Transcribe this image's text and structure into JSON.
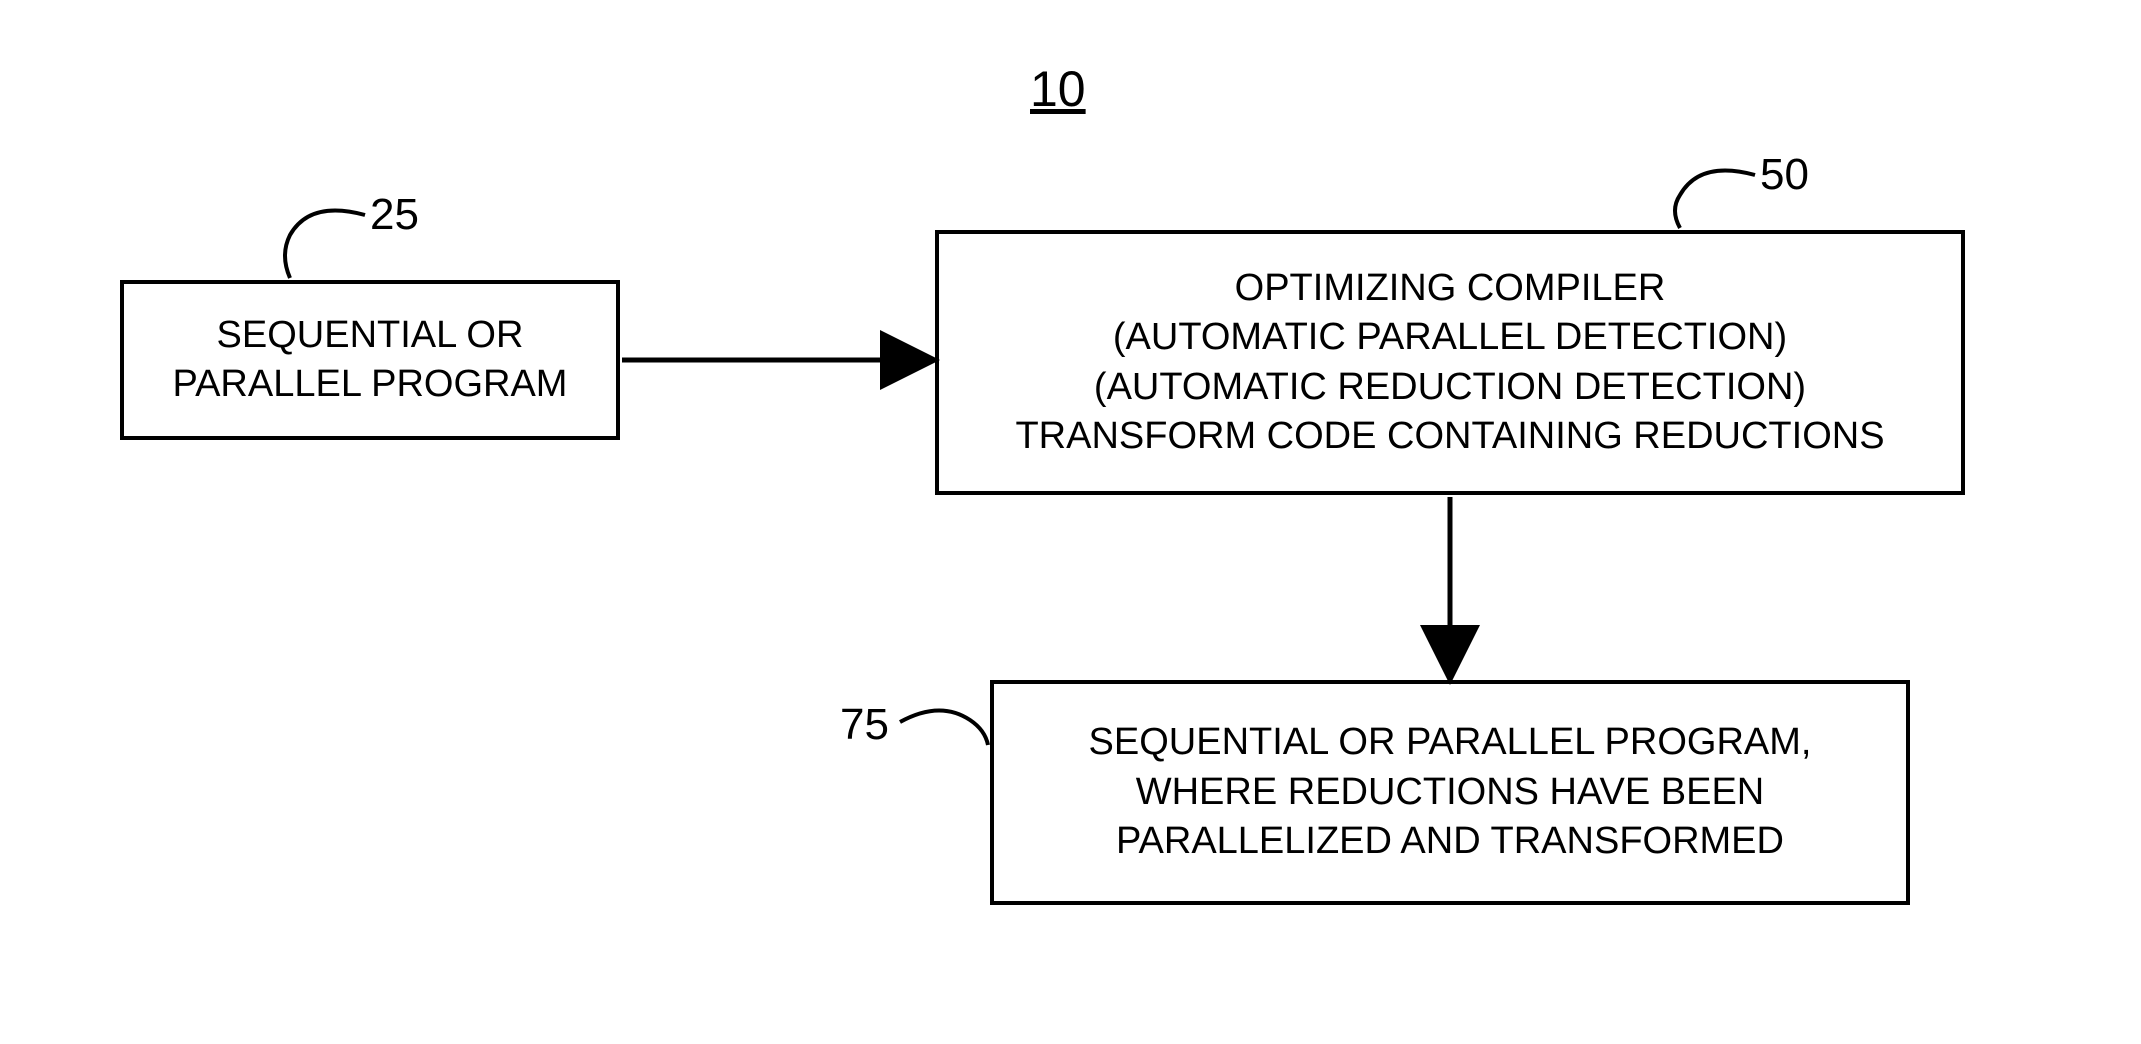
{
  "diagram": {
    "title": "10",
    "labels": {
      "box1": "25",
      "box2": "50",
      "box3": "75"
    },
    "boxes": {
      "b1_line1": "SEQUENTIAL OR",
      "b1_line2": "PARALLEL PROGRAM",
      "b2_line1": "OPTIMIZING COMPILER",
      "b2_line2": "(AUTOMATIC PARALLEL DETECTION)",
      "b2_line3": "(AUTOMATIC REDUCTION DETECTION)",
      "b2_line4": "TRANSFORM CODE CONTAINING REDUCTIONS",
      "b3_line1": "SEQUENTIAL OR PARALLEL PROGRAM,",
      "b3_line2": "WHERE REDUCTIONS HAVE BEEN",
      "b3_line3": "PARALLELIZED AND TRANSFORMED"
    }
  }
}
